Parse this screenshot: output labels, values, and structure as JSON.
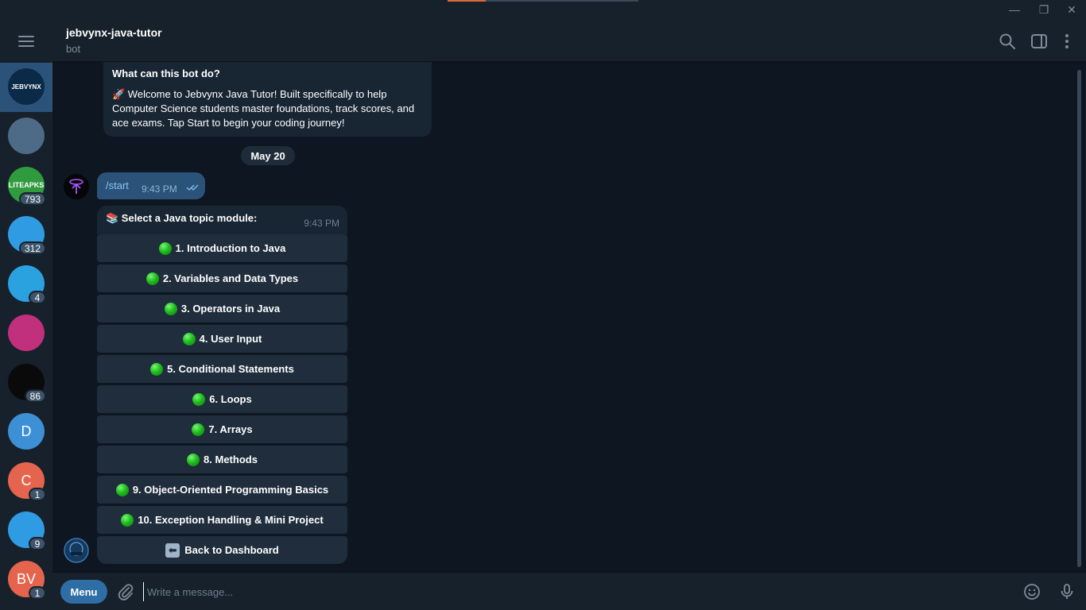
{
  "window": {
    "min_glyph": "—",
    "max_glyph": "❐",
    "close_glyph": "✕"
  },
  "rail": {
    "items": [
      {
        "name": "chat-jebvynx",
        "initials": "",
        "badge": "",
        "color": "#0b2a48",
        "label": "JEBVYNX"
      },
      {
        "name": "chat-portrait",
        "initials": "",
        "badge": "",
        "color": "#4d6a86"
      },
      {
        "name": "chat-liteapks",
        "initials": "",
        "badge": "793",
        "color": "#2f9a3e",
        "label": "LITEAPKS"
      },
      {
        "name": "chat-wallet-a",
        "initials": "",
        "badge": "312",
        "color": "#2f9be3"
      },
      {
        "name": "chat-telegram",
        "initials": "",
        "badge": "4",
        "color": "#2aa2e0"
      },
      {
        "name": "chat-colorful",
        "initials": "",
        "badge": "",
        "color": "#c0307d"
      },
      {
        "name": "chat-telegram-dark",
        "initials": "",
        "badge": "86",
        "color": "#0a0a0a"
      },
      {
        "name": "chat-d",
        "initials": "D",
        "badge": "",
        "color": "#3d8fd6"
      },
      {
        "name": "chat-c",
        "initials": "C",
        "badge": "1",
        "color": "#e5644d"
      },
      {
        "name": "chat-wallet-b",
        "initials": "",
        "badge": "9",
        "color": "#2f9be3"
      },
      {
        "name": "chat-bv",
        "initials": "BV",
        "badge": "1",
        "color": "#e5644d"
      }
    ]
  },
  "header": {
    "title": "jebvynx-java-tutor",
    "subtitle": "bot"
  },
  "info": {
    "question": "What can this bot do?",
    "text": "🚀 Welcome to Jebvynx Java Tutor! Built specifically to help Computer Science students master foundations, track scores, and ace exams. Tap Start to begin your coding journey!"
  },
  "date": "May 20",
  "outgoing": {
    "command": "/start",
    "time": "9:43 PM"
  },
  "bot_message": {
    "text": "📚 Select a Java topic module:",
    "time": "9:43 PM"
  },
  "keyboard": [
    "1. Introduction to Java",
    "2. Variables and Data Types",
    "3. Operators in Java",
    "4. User Input",
    "5. Conditional Statements",
    "6. Loops",
    "7. Arrays",
    "8. Methods",
    "9. Object-Oriented Programming Basics",
    "10. Exception Handling & Mini Project"
  ],
  "back_button": "Back to Dashboard",
  "composer": {
    "menu_label": "Menu",
    "placeholder": "Write a message..."
  },
  "colors": {
    "accent": "#2f6ea5",
    "bubble_out": "#2b5278",
    "bubble_in": "#182533",
    "background": "#0e1621"
  }
}
